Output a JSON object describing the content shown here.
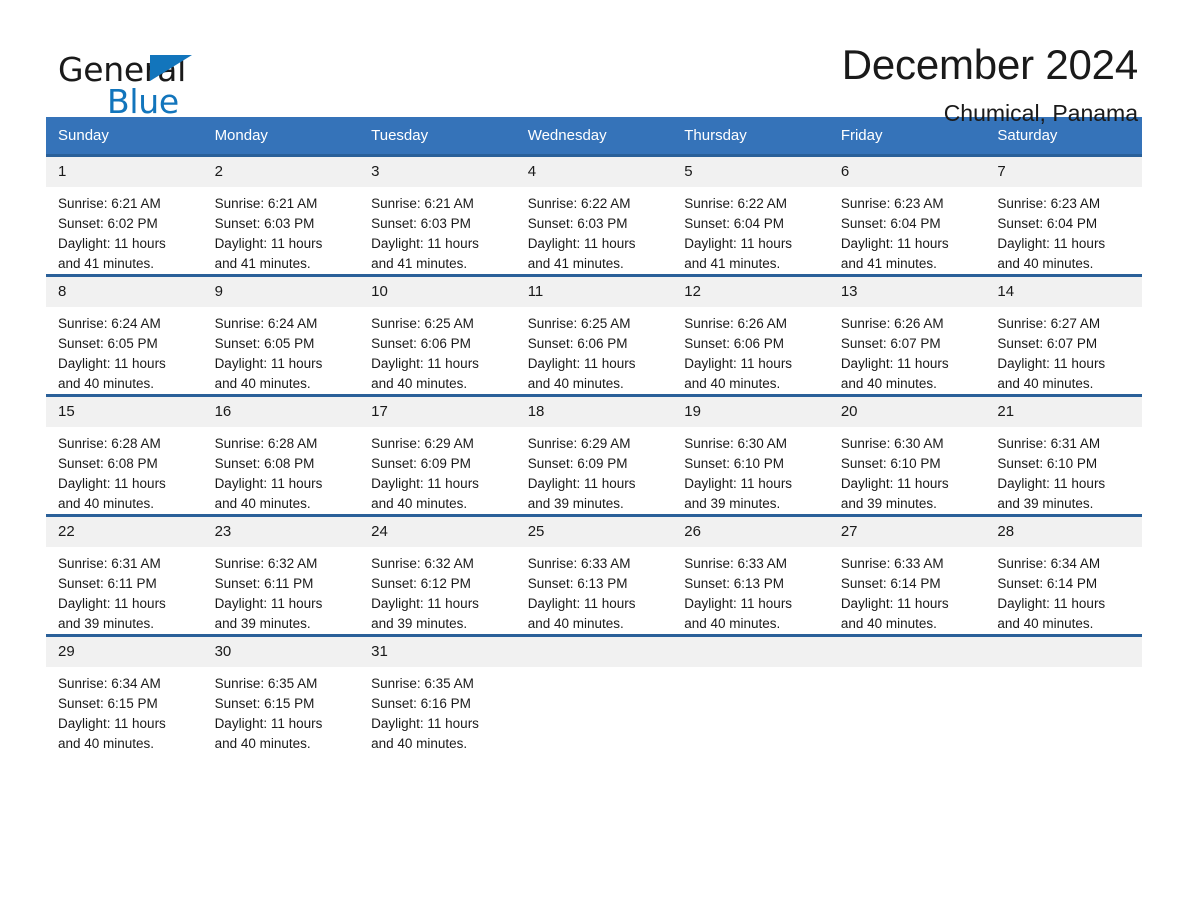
{
  "logo": {
    "line1": "General",
    "line2": "Blue",
    "triangle_color": "#1275bc",
    "text_color": "#1a1a1a"
  },
  "header": {
    "title": "December 2024",
    "subtitle": "Chumical, Panama"
  },
  "theme": {
    "header_bg": "#3573b9",
    "header_text": "#ffffff",
    "week_rule": "#2a6099",
    "daynum_bg": "#f1f1f1",
    "body_text": "#1a1a1a",
    "page_bg": "#ffffff"
  },
  "calendar": {
    "weekdays": [
      "Sunday",
      "Monday",
      "Tuesday",
      "Wednesday",
      "Thursday",
      "Friday",
      "Saturday"
    ],
    "weeks": [
      [
        {
          "day": "1",
          "sunrise": "Sunrise: 6:21 AM",
          "sunset": "Sunset: 6:02 PM",
          "daylight1": "Daylight: 11 hours",
          "daylight2": "and 41 minutes."
        },
        {
          "day": "2",
          "sunrise": "Sunrise: 6:21 AM",
          "sunset": "Sunset: 6:03 PM",
          "daylight1": "Daylight: 11 hours",
          "daylight2": "and 41 minutes."
        },
        {
          "day": "3",
          "sunrise": "Sunrise: 6:21 AM",
          "sunset": "Sunset: 6:03 PM",
          "daylight1": "Daylight: 11 hours",
          "daylight2": "and 41 minutes."
        },
        {
          "day": "4",
          "sunrise": "Sunrise: 6:22 AM",
          "sunset": "Sunset: 6:03 PM",
          "daylight1": "Daylight: 11 hours",
          "daylight2": "and 41 minutes."
        },
        {
          "day": "5",
          "sunrise": "Sunrise: 6:22 AM",
          "sunset": "Sunset: 6:04 PM",
          "daylight1": "Daylight: 11 hours",
          "daylight2": "and 41 minutes."
        },
        {
          "day": "6",
          "sunrise": "Sunrise: 6:23 AM",
          "sunset": "Sunset: 6:04 PM",
          "daylight1": "Daylight: 11 hours",
          "daylight2": "and 41 minutes."
        },
        {
          "day": "7",
          "sunrise": "Sunrise: 6:23 AM",
          "sunset": "Sunset: 6:04 PM",
          "daylight1": "Daylight: 11 hours",
          "daylight2": "and 40 minutes."
        }
      ],
      [
        {
          "day": "8",
          "sunrise": "Sunrise: 6:24 AM",
          "sunset": "Sunset: 6:05 PM",
          "daylight1": "Daylight: 11 hours",
          "daylight2": "and 40 minutes."
        },
        {
          "day": "9",
          "sunrise": "Sunrise: 6:24 AM",
          "sunset": "Sunset: 6:05 PM",
          "daylight1": "Daylight: 11 hours",
          "daylight2": "and 40 minutes."
        },
        {
          "day": "10",
          "sunrise": "Sunrise: 6:25 AM",
          "sunset": "Sunset: 6:06 PM",
          "daylight1": "Daylight: 11 hours",
          "daylight2": "and 40 minutes."
        },
        {
          "day": "11",
          "sunrise": "Sunrise: 6:25 AM",
          "sunset": "Sunset: 6:06 PM",
          "daylight1": "Daylight: 11 hours",
          "daylight2": "and 40 minutes."
        },
        {
          "day": "12",
          "sunrise": "Sunrise: 6:26 AM",
          "sunset": "Sunset: 6:06 PM",
          "daylight1": "Daylight: 11 hours",
          "daylight2": "and 40 minutes."
        },
        {
          "day": "13",
          "sunrise": "Sunrise: 6:26 AM",
          "sunset": "Sunset: 6:07 PM",
          "daylight1": "Daylight: 11 hours",
          "daylight2": "and 40 minutes."
        },
        {
          "day": "14",
          "sunrise": "Sunrise: 6:27 AM",
          "sunset": "Sunset: 6:07 PM",
          "daylight1": "Daylight: 11 hours",
          "daylight2": "and 40 minutes."
        }
      ],
      [
        {
          "day": "15",
          "sunrise": "Sunrise: 6:28 AM",
          "sunset": "Sunset: 6:08 PM",
          "daylight1": "Daylight: 11 hours",
          "daylight2": "and 40 minutes."
        },
        {
          "day": "16",
          "sunrise": "Sunrise: 6:28 AM",
          "sunset": "Sunset: 6:08 PM",
          "daylight1": "Daylight: 11 hours",
          "daylight2": "and 40 minutes."
        },
        {
          "day": "17",
          "sunrise": "Sunrise: 6:29 AM",
          "sunset": "Sunset: 6:09 PM",
          "daylight1": "Daylight: 11 hours",
          "daylight2": "and 40 minutes."
        },
        {
          "day": "18",
          "sunrise": "Sunrise: 6:29 AM",
          "sunset": "Sunset: 6:09 PM",
          "daylight1": "Daylight: 11 hours",
          "daylight2": "and 39 minutes."
        },
        {
          "day": "19",
          "sunrise": "Sunrise: 6:30 AM",
          "sunset": "Sunset: 6:10 PM",
          "daylight1": "Daylight: 11 hours",
          "daylight2": "and 39 minutes."
        },
        {
          "day": "20",
          "sunrise": "Sunrise: 6:30 AM",
          "sunset": "Sunset: 6:10 PM",
          "daylight1": "Daylight: 11 hours",
          "daylight2": "and 39 minutes."
        },
        {
          "day": "21",
          "sunrise": "Sunrise: 6:31 AM",
          "sunset": "Sunset: 6:10 PM",
          "daylight1": "Daylight: 11 hours",
          "daylight2": "and 39 minutes."
        }
      ],
      [
        {
          "day": "22",
          "sunrise": "Sunrise: 6:31 AM",
          "sunset": "Sunset: 6:11 PM",
          "daylight1": "Daylight: 11 hours",
          "daylight2": "and 39 minutes."
        },
        {
          "day": "23",
          "sunrise": "Sunrise: 6:32 AM",
          "sunset": "Sunset: 6:11 PM",
          "daylight1": "Daylight: 11 hours",
          "daylight2": "and 39 minutes."
        },
        {
          "day": "24",
          "sunrise": "Sunrise: 6:32 AM",
          "sunset": "Sunset: 6:12 PM",
          "daylight1": "Daylight: 11 hours",
          "daylight2": "and 39 minutes."
        },
        {
          "day": "25",
          "sunrise": "Sunrise: 6:33 AM",
          "sunset": "Sunset: 6:13 PM",
          "daylight1": "Daylight: 11 hours",
          "daylight2": "and 40 minutes."
        },
        {
          "day": "26",
          "sunrise": "Sunrise: 6:33 AM",
          "sunset": "Sunset: 6:13 PM",
          "daylight1": "Daylight: 11 hours",
          "daylight2": "and 40 minutes."
        },
        {
          "day": "27",
          "sunrise": "Sunrise: 6:33 AM",
          "sunset": "Sunset: 6:14 PM",
          "daylight1": "Daylight: 11 hours",
          "daylight2": "and 40 minutes."
        },
        {
          "day": "28",
          "sunrise": "Sunrise: 6:34 AM",
          "sunset": "Sunset: 6:14 PM",
          "daylight1": "Daylight: 11 hours",
          "daylight2": "and 40 minutes."
        }
      ],
      [
        {
          "day": "29",
          "sunrise": "Sunrise: 6:34 AM",
          "sunset": "Sunset: 6:15 PM",
          "daylight1": "Daylight: 11 hours",
          "daylight2": "and 40 minutes."
        },
        {
          "day": "30",
          "sunrise": "Sunrise: 6:35 AM",
          "sunset": "Sunset: 6:15 PM",
          "daylight1": "Daylight: 11 hours",
          "daylight2": "and 40 minutes."
        },
        {
          "day": "31",
          "sunrise": "Sunrise: 6:35 AM",
          "sunset": "Sunset: 6:16 PM",
          "daylight1": "Daylight: 11 hours",
          "daylight2": "and 40 minutes."
        },
        {
          "day": "",
          "sunrise": "",
          "sunset": "",
          "daylight1": "",
          "daylight2": ""
        },
        {
          "day": "",
          "sunrise": "",
          "sunset": "",
          "daylight1": "",
          "daylight2": ""
        },
        {
          "day": "",
          "sunrise": "",
          "sunset": "",
          "daylight1": "",
          "daylight2": ""
        },
        {
          "day": "",
          "sunrise": "",
          "sunset": "",
          "daylight1": "",
          "daylight2": ""
        }
      ]
    ]
  }
}
